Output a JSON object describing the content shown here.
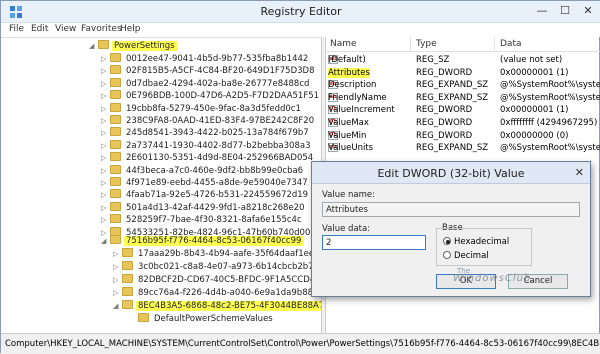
{
  "window": {
    "title": "Registry Editor",
    "minimize": "—",
    "maximize": "☐",
    "close": "✕"
  },
  "menu": [
    "File",
    "Edit",
    "View",
    "Favorites",
    "Help"
  ],
  "tree": {
    "parent": "PowerSettings",
    "items": [
      "0012ee47-9041-4b5d-9b77-535fba8b1442",
      "02F815B5-A5CF-4C84-BF20-649D1F75D3D8",
      "0d7dbae2-4294-402a-ba8e-26777e8488cd",
      "0E796BDB-100D-47D6-A2D5-F7D2DAA51F51",
      "19cbb8fa-5279-450e-9fac-8a3d5fedd0c1",
      "238C9FA8-0AAD-41ED-83F4-97BE242C8F20",
      "245d8541-3943-4422-b025-13a784f679b7",
      "2a737441-1930-4402-8d77-b2bebba308a3",
      "2E601130-5351-4d9d-8E04-252966BAD054",
      "44f3beca-a7c0-460e-9df2-bb8b99e0cba6",
      "4f971e89-eebd-4455-a8de-9e59040e7347",
      "4faab71a-92e5-4726-b531-224559672d19",
      "501a4d13-42af-4429-9fd1-a8218c268e20",
      "528259f7-7bae-4f30-8321-8afa6e155c4c",
      "54533251-82be-4824-96c1-47b60b740d00"
    ],
    "selected_parent": "7516b95f-f776-4464-8c53-06167f40cc99",
    "children": [
      "17aaa29b-8b43-4b94-aafe-35f64daaf1ee",
      "3c0bc021-c8a8-4e07-a973-6b14cbcb2b7e",
      "82DBCF2D-CD67-40C5-BFDC-9F1A5CCD4663",
      "89cc76a4-f226-4d4b-a040-6e9a1da9b882"
    ],
    "selected": "8EC4B3A5-6868-48c2-BE75-4F3044BE88A7",
    "grandchild": "DefaultPowerSchemeValues"
  },
  "list": {
    "headers": [
      "Name",
      "Type",
      "Data"
    ],
    "rows": [
      {
        "name": "(Default)",
        "type": "REG_SZ",
        "data": "(value not set)",
        "icon": "ab"
      },
      {
        "name": "Attributes",
        "type": "REG_DWORD",
        "data": "0x00000001 (1)",
        "icon": "bin"
      },
      {
        "name": "Description",
        "type": "REG_EXPAND_SZ",
        "data": "@%SystemRoot%\\system",
        "icon": "ab"
      },
      {
        "name": "FriendlyName",
        "type": "REG_EXPAND_SZ",
        "data": "@%SystemRoot%\\system",
        "icon": "ab"
      },
      {
        "name": "ValueIncrement",
        "type": "REG_DWORD",
        "data": "0x00000001 (1)",
        "icon": "bin"
      },
      {
        "name": "ValueMax",
        "type": "REG_DWORD",
        "data": "0xffffffff (4294967295)",
        "icon": "bin"
      },
      {
        "name": "ValueMin",
        "type": "REG_DWORD",
        "data": "0x00000000 (0)",
        "icon": "bin"
      },
      {
        "name": "ValueUnits",
        "type": "REG_EXPAND_SZ",
        "data": "@%SystemRoot%\\system",
        "icon": "ab"
      }
    ]
  },
  "status": "Computer\\HKEY_LOCAL_MACHINE\\SYSTEM\\CurrentControlSet\\Control\\Power\\PowerSettings\\7516b95f-f776-4464-8c53-06167f40cc99\\8EC4B3A5-6868-48c2-BE75-4F3044BE88A7",
  "dialog": {
    "title": "Edit DWORD (32-bit) Value",
    "close": "✕",
    "value_name_label": "Value name:",
    "value_name": "Attributes",
    "value_data_label": "Value data:",
    "value_data": "2",
    "base_label": "Base",
    "hex_label": "Hexadecimal",
    "dec_label": "Decimal",
    "base_selected": "Hexadecimal",
    "ok": "OK",
    "cancel": "Cancel"
  },
  "watermark": {
    "line1": "The",
    "line2": "WindowsClub"
  }
}
